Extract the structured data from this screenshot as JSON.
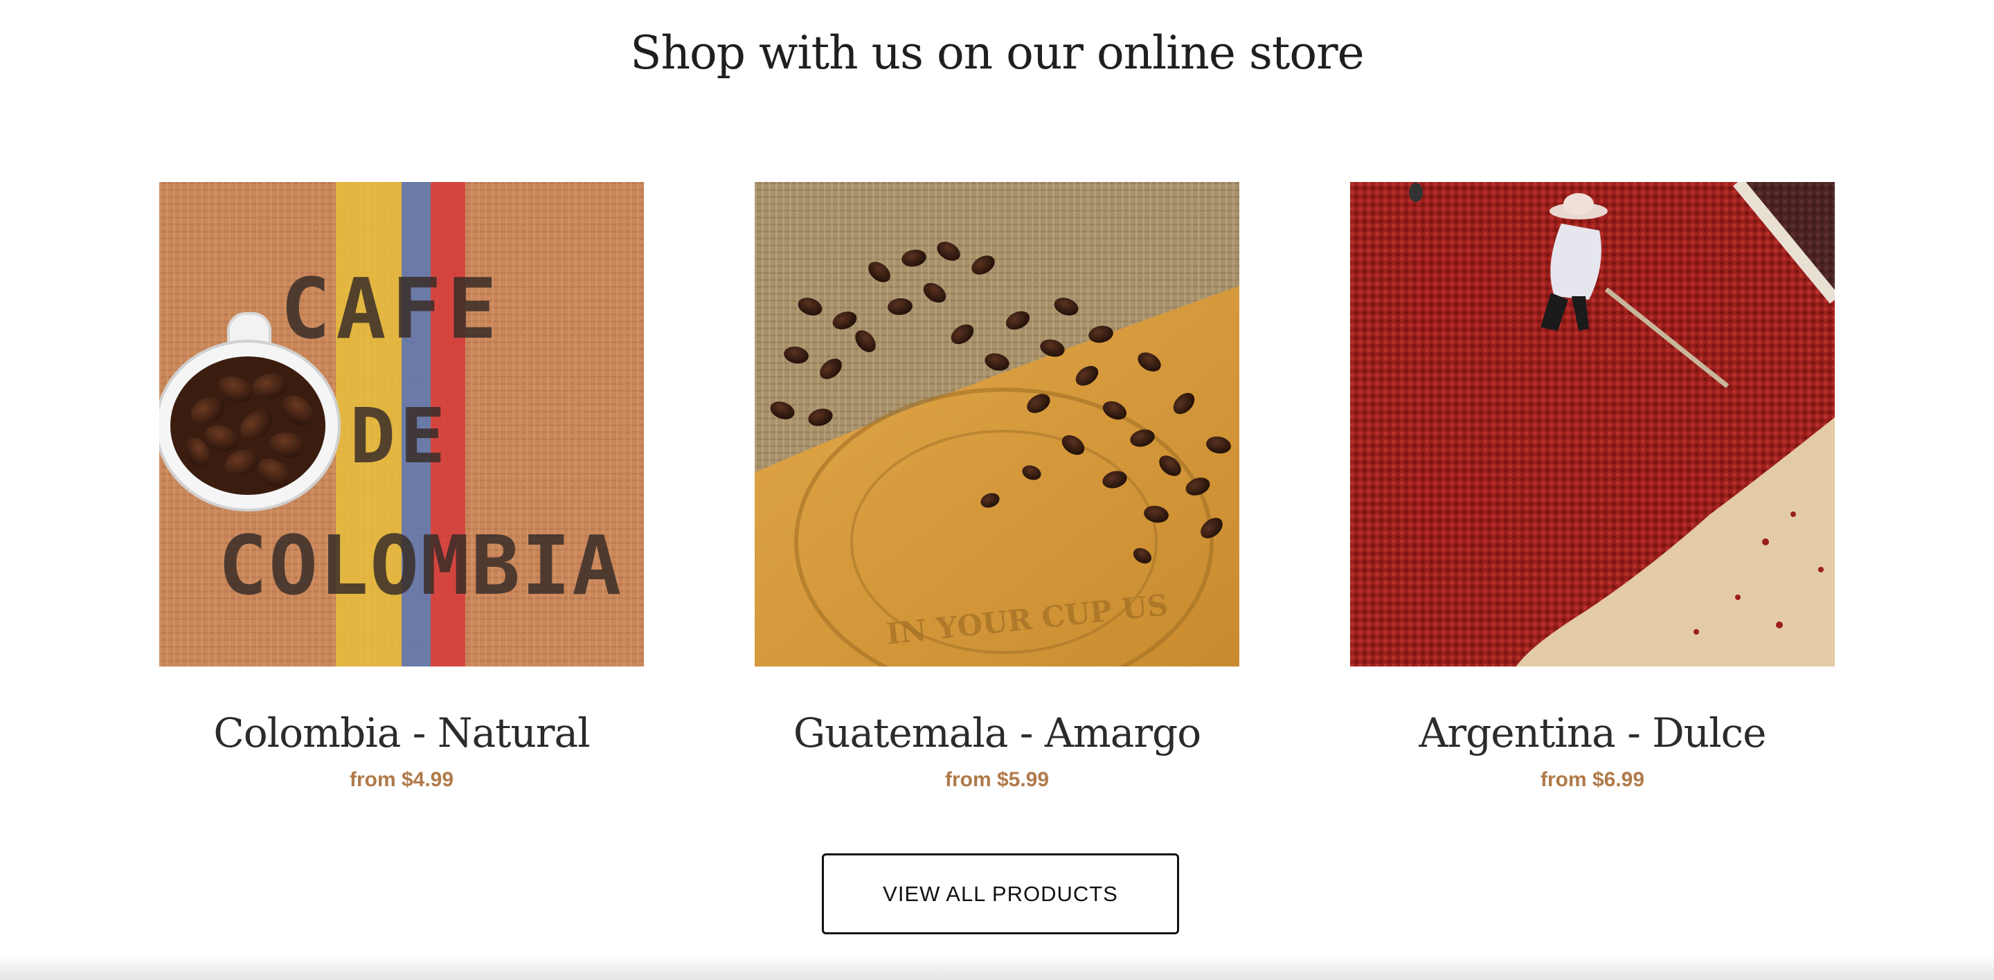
{
  "section": {
    "title": "Shop with us on our online store"
  },
  "products": [
    {
      "name": "Colombia - Natural",
      "price": "from $4.99",
      "image_text": [
        "CAFE",
        "DE",
        "COLOMBIA"
      ]
    },
    {
      "name": "Guatemala - Amargo",
      "price": "from $5.99",
      "image_text": [
        "IN YOUR CUP US"
      ]
    },
    {
      "name": "Argentina - Dulce",
      "price": "from $6.99"
    }
  ],
  "cta": {
    "label": "VIEW ALL PRODUCTS"
  },
  "colors": {
    "price": "#b07a4a",
    "title": "#1f1f1f",
    "button_border": "#111111"
  }
}
